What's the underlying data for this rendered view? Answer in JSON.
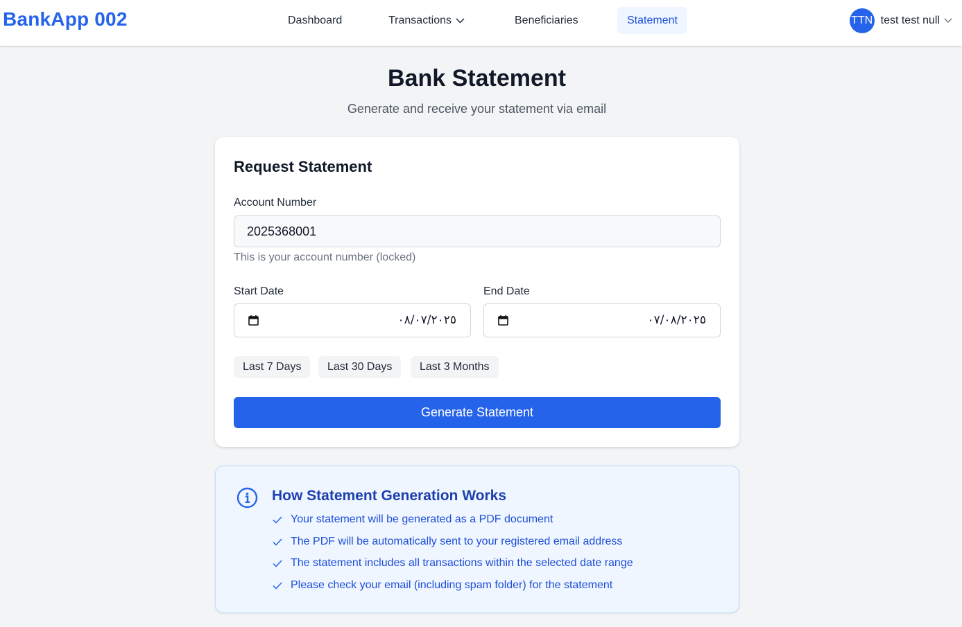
{
  "header": {
    "brand": "BankApp 002",
    "nav": [
      {
        "label": "Dashboard"
      },
      {
        "label": "Transactions"
      },
      {
        "label": "Beneficiaries"
      },
      {
        "label": "Statement"
      }
    ],
    "user": {
      "initials": "TTN",
      "name": "test test null"
    }
  },
  "page": {
    "title": "Bank Statement",
    "subtitle": "Generate and receive your statement via email"
  },
  "form": {
    "title": "Request Statement",
    "account_label": "Account Number",
    "account_value": "2025368001",
    "account_hint": "This is your account number (locked)",
    "start_label": "Start Date",
    "start_value": "٠٨/٠٧/٢٠٢٥",
    "end_label": "End Date",
    "end_value": "٠٧/٠٨/٢٠٢٥",
    "quick_ranges": [
      "Last 7 Days",
      "Last 30 Days",
      "Last 3 Months"
    ],
    "submit_label": "Generate Statement"
  },
  "info": {
    "title": "How Statement Generation Works",
    "items": [
      "Your statement will be generated as a PDF document",
      "The PDF will be automatically sent to your registered email address",
      "The statement includes all transactions within the selected date range",
      "Please check your email (including spam folder) for the statement"
    ]
  },
  "colors": {
    "primary": "#2563eb",
    "active_nav_bg": "#eff6ff",
    "info_bg": "#eff6ff",
    "info_text": "#1d4ed8"
  }
}
